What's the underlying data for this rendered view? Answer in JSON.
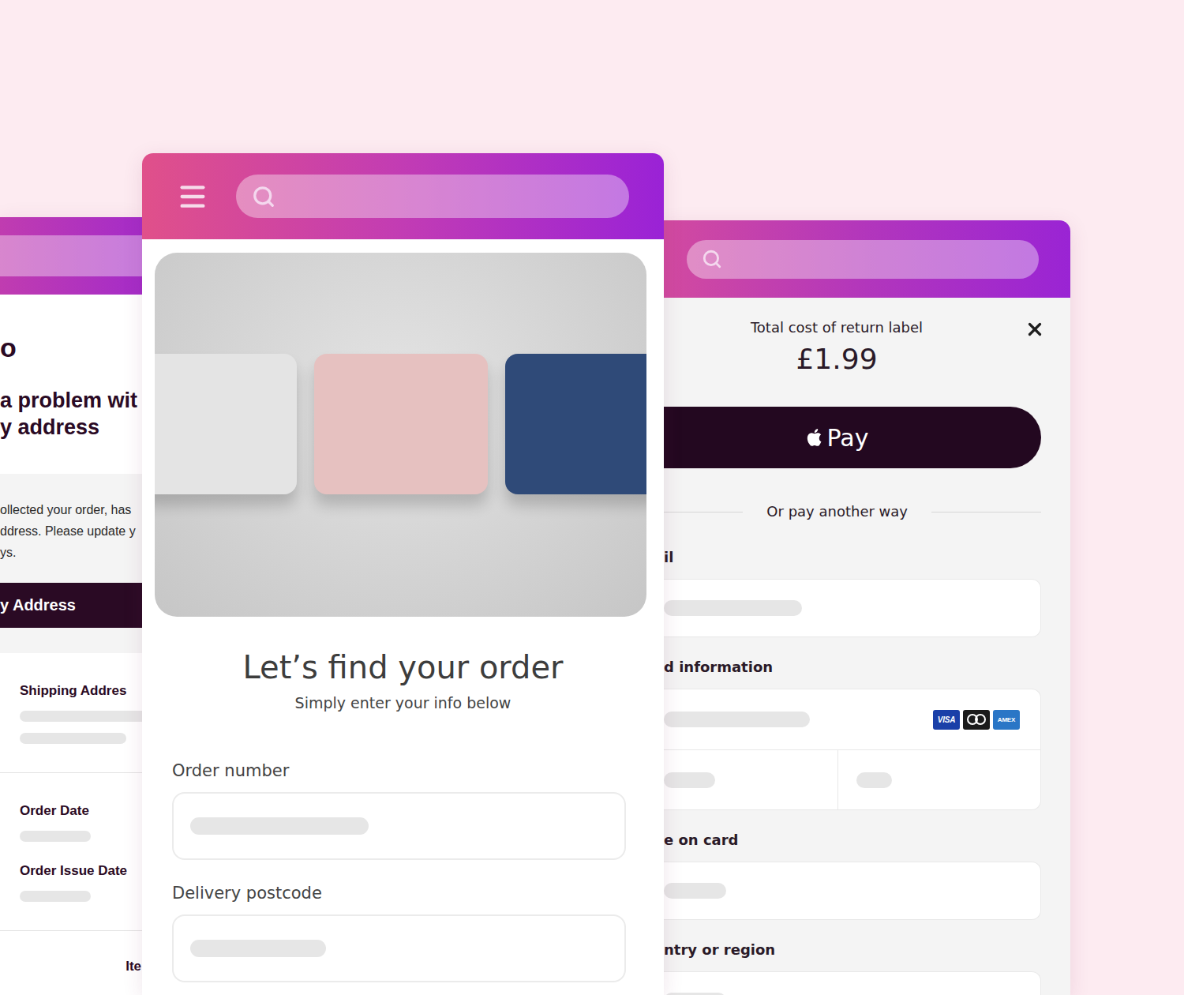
{
  "left_screen": {
    "heading": "o",
    "subheading": [
      "a problem wit",
      "y address"
    ],
    "notice": [
      "ollected your order, has",
      "ddress. Please update y",
      "ys."
    ],
    "button": "y Address",
    "details": [
      {
        "items": [
          {
            "label": "Shipping Addres",
            "placeholder_lines": 2
          }
        ]
      },
      {
        "items": [
          {
            "label": "Order Date",
            "placeholder_lines": 1
          },
          {
            "label": "Order Issue Date",
            "placeholder_lines": 1
          }
        ]
      }
    ],
    "items_label": "Ite"
  },
  "center_screen": {
    "title": "Let’s find your order",
    "subtitle": "Simply enter your info below",
    "fields": [
      {
        "label": "Order number"
      },
      {
        "label": "Delivery postcode"
      }
    ]
  },
  "right_screen": {
    "summary_label": "Total cost of return label",
    "price": "£1.99",
    "wallet_button": "Pay",
    "divider": "Or pay another way",
    "fields": [
      {
        "label": "il",
        "kind": "single"
      },
      {
        "label": "d information",
        "kind": "card"
      },
      {
        "label": "e on card",
        "kind": "single"
      },
      {
        "label": "ntry or region",
        "kind": "single"
      }
    ],
    "card_brands": [
      {
        "kind": "visa",
        "label": "VISA"
      },
      {
        "kind": "mastercard"
      },
      {
        "kind": "amex",
        "label": "AMEX"
      }
    ]
  }
}
